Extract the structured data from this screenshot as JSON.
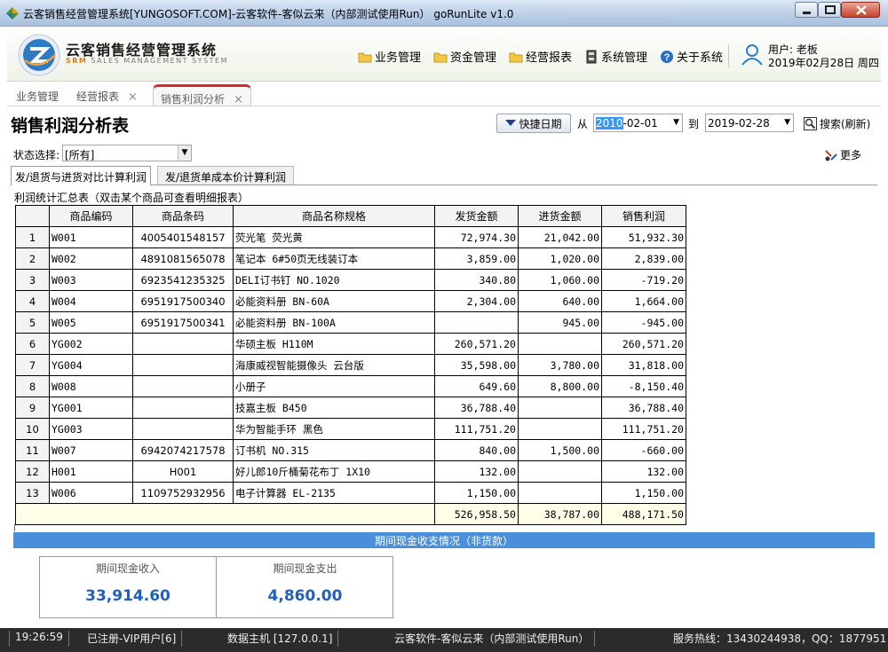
{
  "window": {
    "title": "云客销售经营管理系统[YUNGOSOFT.COM]-云客软件-客似云来（内部测试使用Run） goRunLite v1.0"
  },
  "header": {
    "app_name": "云客销售经营管理系统",
    "app_sub_prefix": "SRM",
    "app_sub_rest": " SALES MANAGEMENT SYSTEM",
    "menu": {
      "business": "业务管理",
      "finance": "资金管理",
      "reports": "经营报表",
      "system": "系统管理",
      "about": "关于系统"
    },
    "user_label": "用户: 老板",
    "user_date": "2019年02月28日 周四"
  },
  "tabs": {
    "business": "业务管理",
    "reports": "经营报表",
    "profit": "销售利润分析",
    "close": "×"
  },
  "page": {
    "title": "销售利润分析表",
    "quick_date": "快捷日期",
    "from": "从",
    "date_from_selected": "2010",
    "date_from_rest": "-02-01",
    "to": "到",
    "date_to": "2019-02-28",
    "search": "搜索(刷新)",
    "status_label": "状态选择:",
    "status_value": "[所有]",
    "more": "更多",
    "subtab1": "发/退货与进货对比计算利润",
    "subtab2": "发/退货单成本价计算利润",
    "summary_label": "利润统计汇总表（双击某个商品可查看明细报表）"
  },
  "table": {
    "columns": [
      "",
      "商品编码",
      "商品条码",
      "商品名称规格",
      "发货金额",
      "进货金额",
      "销售利润"
    ],
    "rows": [
      [
        "1",
        "W001",
        "4005401548157",
        "荧光笔 荧光黄",
        "72,974.30",
        "21,042.00",
        "51,932.30"
      ],
      [
        "2",
        "W002",
        "4891081565078",
        "笔记本 6#50页无线装订本",
        "3,859.00",
        "1,020.00",
        "2,839.00"
      ],
      [
        "3",
        "W003",
        "6923541235325",
        "DELI订书钉 NO.1020",
        "340.80",
        "1,060.00",
        "-719.20"
      ],
      [
        "4",
        "W004",
        "6951917500340",
        "必能资料册 BN-60A",
        "2,304.00",
        "640.00",
        "1,664.00"
      ],
      [
        "5",
        "W005",
        "6951917500341",
        "必能资料册 BN-100A",
        "",
        "945.00",
        "-945.00"
      ],
      [
        "6",
        "YG002",
        "",
        "华硕主板 H110M",
        "260,571.20",
        "",
        "260,571.20"
      ],
      [
        "7",
        "YG004",
        "",
        "海康威视智能摄像头 云台版",
        "35,598.00",
        "3,780.00",
        "31,818.00"
      ],
      [
        "8",
        "W008",
        "",
        "小册子",
        "649.60",
        "8,800.00",
        "-8,150.40"
      ],
      [
        "9",
        "YG001",
        "",
        "技嘉主板 B450",
        "36,788.40",
        "",
        "36,788.40"
      ],
      [
        "10",
        "YG003",
        "",
        "华为智能手环 黑色",
        "111,751.20",
        "",
        "111,751.20"
      ],
      [
        "11",
        "W007",
        "6942074217578",
        "订书机 NO.315",
        "840.00",
        "1,500.00",
        "-660.00"
      ],
      [
        "12",
        "H001",
        "H001",
        "好儿郎10斤桶菊花布丁 1X10",
        "132.00",
        "",
        "132.00"
      ],
      [
        "13",
        "W006",
        "1109752932956",
        "电子计算器 EL-2135",
        "1,150.00",
        "",
        "1,150.00"
      ]
    ],
    "totals": {
      "shipped": "526,958.50",
      "purchased": "38,787.00",
      "profit": "488,171.50"
    }
  },
  "cash": {
    "bar": "期间现金收支情况（非货款）",
    "income_label": "期间现金收入",
    "income_value": "33,914.60",
    "expense_label": "期间现金支出",
    "expense_value": "4,860.00"
  },
  "statusbar": {
    "time": "19:26:59",
    "registration": "已注册-VIP用户[6]",
    "host": "数据主机 [127.0.0.1]",
    "company": "云客软件-客似云来（内部测试使用Run）",
    "hotline": "服务热线：13430244938，QQ：1877951"
  },
  "colors": {
    "accent_blue": "#4a8fdc",
    "active_tab_red": "#d9272a",
    "cash_value_blue": "#1f5fbf",
    "date_highlight": "#3399ff"
  },
  "icons": [
    "app-icon",
    "srm-logo-icon",
    "folder-icon",
    "cabinet-icon",
    "help-icon",
    "user-icon",
    "calendar-dropdown-icon",
    "search-icon",
    "more-icon"
  ]
}
